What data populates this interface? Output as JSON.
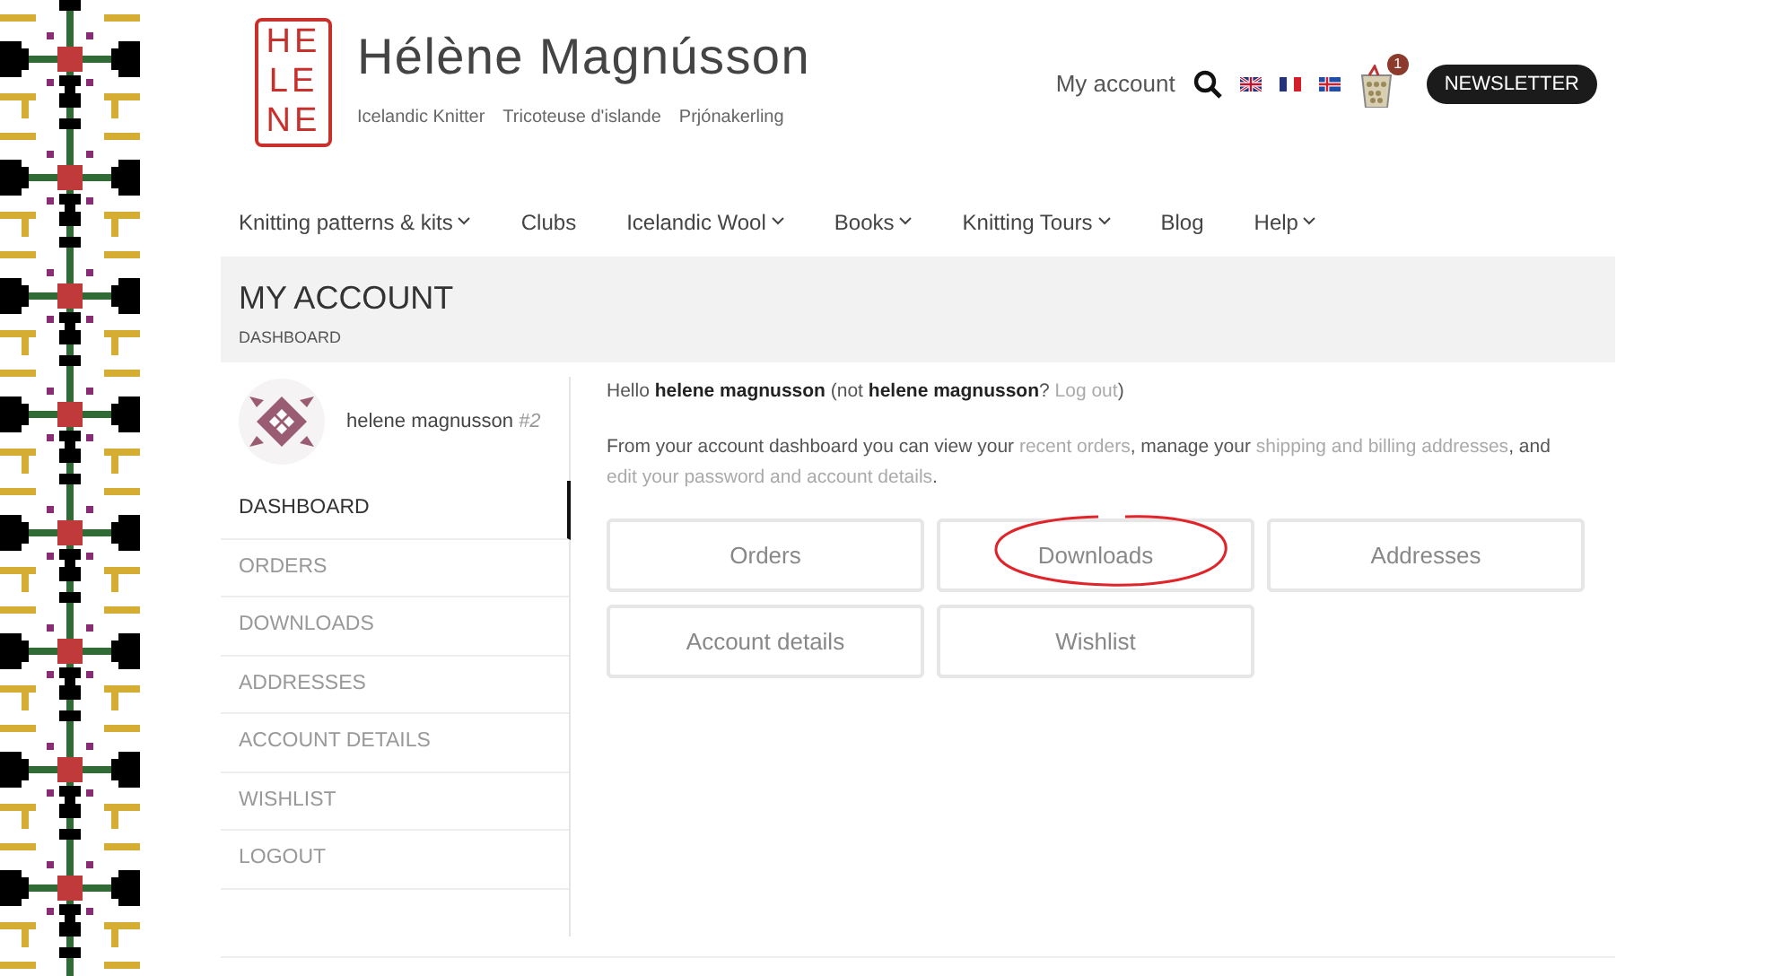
{
  "logo": {
    "letters": [
      "HE",
      "LE",
      "NE"
    ],
    "name": "Hélène Magnússon",
    "taglines": [
      "Icelandic Knitter",
      "Tricoteuse d'islande",
      "Prjónakerling"
    ]
  },
  "header": {
    "account_link": "My account",
    "cart_count": "1",
    "newsletter": "NEWSLETTER",
    "flags": [
      {
        "kind": "uk"
      },
      {
        "kind": "fr"
      },
      {
        "kind": "is"
      }
    ]
  },
  "nav": [
    {
      "label": "Knitting patterns & kits",
      "dropdown": true
    },
    {
      "label": "Clubs",
      "dropdown": false
    },
    {
      "label": "Icelandic Wool",
      "dropdown": true
    },
    {
      "label": "Books",
      "dropdown": true
    },
    {
      "label": "Knitting Tours",
      "dropdown": true
    },
    {
      "label": "Blog",
      "dropdown": false
    },
    {
      "label": "Help",
      "dropdown": true
    }
  ],
  "page_title": "MY ACCOUNT",
  "breadcrumb": "DASHBOARD",
  "user": {
    "name": "helene magnusson",
    "number": "#2"
  },
  "sidebar": [
    {
      "label": "DASHBOARD",
      "selected": true
    },
    {
      "label": "ORDERS",
      "selected": false
    },
    {
      "label": "DOWNLOADS",
      "selected": false
    },
    {
      "label": "ADDRESSES",
      "selected": false
    },
    {
      "label": "ACCOUNT DETAILS",
      "selected": false
    },
    {
      "label": "WISHLIST",
      "selected": false
    },
    {
      "label": "LOGOUT",
      "selected": false
    }
  ],
  "greeting": [
    {
      "kind": "text",
      "text": "Hello **helene magnusson** (not **helene magnusson**? "
    },
    {
      "kind": "link",
      "text": "Log out"
    },
    {
      "kind": "text",
      "text": ")"
    }
  ],
  "intro": [
    {
      "kind": "text",
      "text": "From your account dashboard you can view your "
    },
    {
      "kind": "link",
      "text": "recent orders"
    },
    {
      "kind": "text",
      "text": ", manage your "
    },
    {
      "kind": "link",
      "text": "shipping and billing addresses"
    },
    {
      "kind": "text",
      "text": ", and "
    },
    {
      "kind": "link",
      "text": "edit your password and account details"
    },
    {
      "kind": "text",
      "text": "."
    }
  ],
  "tiles": [
    {
      "label": "Orders",
      "circled": false
    },
    {
      "label": "Downloads",
      "circled": true
    },
    {
      "label": "Addresses",
      "circled": false
    },
    {
      "label": "Account details",
      "circled": false
    },
    {
      "label": "Wishlist",
      "circled": false
    }
  ]
}
